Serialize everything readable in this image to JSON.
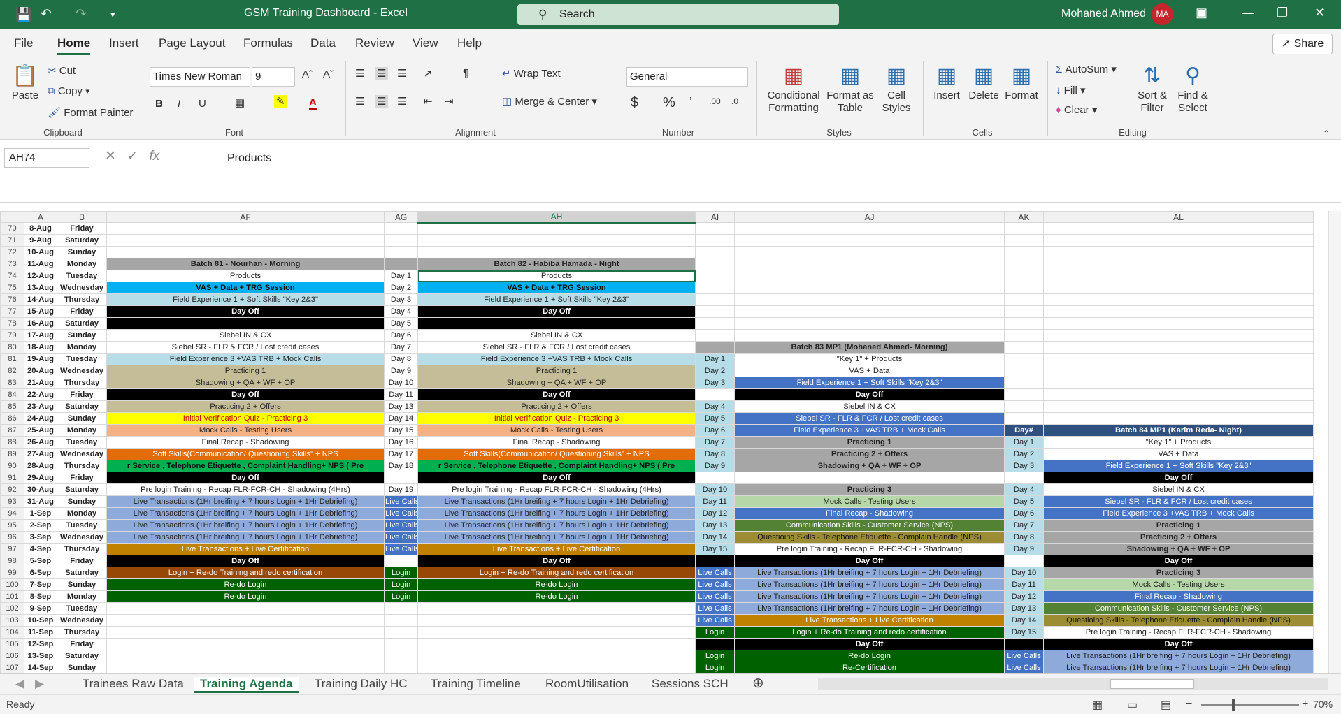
{
  "window": {
    "title": "GSM Training Dashboard  -  Excel",
    "search_placeholder": "Search",
    "user": "Mohaned Ahmed",
    "avatar": "MA"
  },
  "ribbon_tabs": [
    "File",
    "Home",
    "Insert",
    "Page Layout",
    "Formulas",
    "Data",
    "Review",
    "View",
    "Help"
  ],
  "share_label": "Share",
  "ribbon": {
    "clipboard": {
      "paste": "Paste",
      "cut": "Cut",
      "copy": "Copy",
      "format_painter": "Format Painter",
      "label": "Clipboard"
    },
    "font": {
      "name": "Times New Roman",
      "size": "9",
      "label": "Font",
      "bold": "B",
      "italic": "I",
      "underline": "U"
    },
    "alignment": {
      "wrap": "Wrap Text",
      "merge": "Merge & Center",
      "label": "Alignment"
    },
    "number": {
      "format": "General",
      "label": "Number"
    },
    "styles": {
      "cond": "Conditional Formatting",
      "table": "Format as Table",
      "cell": "Cell Styles",
      "label": "Styles"
    },
    "cells": {
      "insert": "Insert",
      "delete": "Delete",
      "format": "Format",
      "label": "Cells"
    },
    "editing": {
      "autosum": "AutoSum",
      "fill": "Fill",
      "clear": "Clear",
      "sort": "Sort & Filter",
      "find": "Find & Select",
      "label": "Editing"
    }
  },
  "formula_bar": {
    "cell_ref": "AH74",
    "content": "Products",
    "fx": "fx"
  },
  "columns": [
    "",
    "A",
    "B",
    "AF",
    "AG",
    "AH",
    "AI",
    "AJ",
    "AK",
    "AL",
    ""
  ],
  "rows": [
    {
      "n": "70",
      "a": "8-Aug",
      "b": "Friday",
      "c": []
    },
    {
      "n": "71",
      "a": "9-Aug",
      "b": "Saturday",
      "c": []
    },
    {
      "n": "72",
      "a": "10-Aug",
      "b": "Sunday",
      "c": []
    },
    {
      "n": "73",
      "a": "11-Aug",
      "b": "Monday",
      "c": [
        [
          "Batch 81  - Nourhan - Morning",
          "gray"
        ],
        [
          "",
          "gray"
        ],
        [
          "Batch 82  - Habiba Hamada - Night",
          "gray"
        ]
      ]
    },
    {
      "n": "74",
      "a": "12-Aug",
      "b": "Tuesday",
      "c": [
        [
          "Products",
          "white"
        ],
        [
          "Day 1",
          "white"
        ],
        [
          "Products",
          "white"
        ]
      ]
    },
    {
      "n": "75",
      "a": "13-Aug",
      "b": "Wednesday",
      "c": [
        [
          "VAS + Data  + TRG Session",
          "cyan"
        ],
        [
          "Day 2",
          "white"
        ],
        [
          "VAS + Data  + TRG Session",
          "cyan"
        ]
      ]
    },
    {
      "n": "76",
      "a": "14-Aug",
      "b": "Thursday",
      "c": [
        [
          "Field Experience 1 + Soft Skills \"Key 2&3\"",
          "lblue"
        ],
        [
          "Day 3",
          "white"
        ],
        [
          "Field Experience 1 + Soft Skills \"Key 2&3\"",
          "lblue"
        ]
      ]
    },
    {
      "n": "77",
      "a": "15-Aug",
      "b": "Friday",
      "c": [
        [
          "Day Off",
          "black"
        ],
        [
          "Day 4",
          "white"
        ],
        [
          "Day Off",
          "black"
        ]
      ]
    },
    {
      "n": "78",
      "a": "16-Aug",
      "b": "Saturday",
      "c": [
        [
          "",
          "black"
        ],
        [
          "Day 5",
          "white"
        ],
        [
          "",
          "black"
        ]
      ]
    },
    {
      "n": "79",
      "a": "17-Aug",
      "b": "Sunday",
      "c": [
        [
          "Siebel IN & CX",
          "white"
        ],
        [
          "Day 6",
          "white"
        ],
        [
          "Siebel IN & CX",
          "white"
        ]
      ]
    },
    {
      "n": "80",
      "a": "18-Aug",
      "b": "Monday",
      "c": [
        [
          "Siebel SR -  FLR & FCR / Lost credit cases",
          "white"
        ],
        [
          "Day 7",
          "white"
        ],
        [
          "Siebel SR -  FLR & FCR / Lost credit cases",
          "white"
        ],
        [
          "",
          "gray"
        ],
        [
          "Batch 83 MP1 (Mohaned Ahmed- Morning)",
          "gray"
        ]
      ]
    },
    {
      "n": "81",
      "a": "19-Aug",
      "b": "Tuesday",
      "c": [
        [
          "Field Experience 3 +VAS TRB + Mock Calls",
          "lblue"
        ],
        [
          "Day 8",
          "white"
        ],
        [
          "Field Experience 3 +VAS TRB + Mock Calls",
          "lblue"
        ],
        [
          "Day 1",
          "lblue"
        ],
        [
          "\"Key 1\" + Products",
          "white"
        ]
      ]
    },
    {
      "n": "82",
      "a": "20-Aug",
      "b": "Wednesday",
      "c": [
        [
          "Practicing 1",
          "tan"
        ],
        [
          "Day 9",
          "white"
        ],
        [
          "Practicing 1",
          "tan"
        ],
        [
          "Day 2",
          "lblue"
        ],
        [
          "VAS + Data",
          "white"
        ]
      ]
    },
    {
      "n": "83",
      "a": "21-Aug",
      "b": "Thursday",
      "c": [
        [
          "Shadowing  + QA +  WF + OP",
          "tan"
        ],
        [
          "Day 10",
          "white"
        ],
        [
          "Shadowing  + QA +  WF + OP",
          "tan"
        ],
        [
          "Day 3",
          "lblue"
        ],
        [
          "Field Experience 1 + Soft Skills \"Key 2&3\"",
          "blue"
        ]
      ]
    },
    {
      "n": "84",
      "a": "22-Aug",
      "b": "Friday",
      "c": [
        [
          "Day Off",
          "black"
        ],
        [
          "Day 11",
          "white"
        ],
        [
          "Day Off",
          "black"
        ],
        [
          "",
          "white"
        ],
        [
          "Day Off",
          "black"
        ]
      ]
    },
    {
      "n": "85",
      "a": "23-Aug",
      "b": "Saturday",
      "c": [
        [
          "Practicing 2  + Offers",
          "tan"
        ],
        [
          "Day 13",
          "white"
        ],
        [
          "Practicing 2  + Offers",
          "tan"
        ],
        [
          "Day 4",
          "lblue"
        ],
        [
          "Siebel IN & CX",
          "white"
        ]
      ]
    },
    {
      "n": "86",
      "a": "24-Aug",
      "b": "Sunday",
      "c": [
        [
          "Initial Verification Quiz - Practicing 3",
          "yellow"
        ],
        [
          "Day 14",
          "white"
        ],
        [
          "Initial Verification Quiz - Practicing 3",
          "yellow"
        ],
        [
          "Day 5",
          "lblue"
        ],
        [
          "Siebel SR -  FLR & FCR / Lost credit cases",
          "blue"
        ]
      ]
    },
    {
      "n": "87",
      "a": "25-Aug",
      "b": "Monday",
      "c": [
        [
          "Mock Calls - Testing Users",
          "peach"
        ],
        [
          "Day 15",
          "white"
        ],
        [
          "Mock Calls - Testing Users",
          "peach"
        ],
        [
          "Day 6",
          "lblue"
        ],
        [
          "Field Experience 3 +VAS TRB + Mock Calls",
          "blue"
        ],
        [
          "Day#",
          "dblue"
        ],
        [
          "Batch 84 MP1 (Karim Reda- Night)",
          "dblue"
        ]
      ]
    },
    {
      "n": "88",
      "a": "26-Aug",
      "b": "Tuesday",
      "c": [
        [
          "Final Recap - Shadowing",
          "white"
        ],
        [
          "Day 16",
          "white"
        ],
        [
          "Final Recap - Shadowing",
          "white"
        ],
        [
          "Day 7",
          "lblue"
        ],
        [
          "Practicing 1",
          "gray"
        ],
        [
          "Day 1",
          "lblue"
        ],
        [
          "\"Key 1\" + Products",
          "white"
        ]
      ]
    },
    {
      "n": "89",
      "a": "27-Aug",
      "b": "Wednesday",
      "c": [
        [
          "Soft Skills(Communication/ Questioning Skills\" + NPS",
          "orange"
        ],
        [
          "Day 17",
          "white"
        ],
        [
          "Soft Skills(Communication/ Questioning Skills\" + NPS",
          "orange"
        ],
        [
          "Day 8",
          "lblue"
        ],
        [
          "Practicing 2  + Offers",
          "gray"
        ],
        [
          "Day 2",
          "lblue"
        ],
        [
          "VAS + Data",
          "white"
        ]
      ]
    },
    {
      "n": "90",
      "a": "28-Aug",
      "b": "Thursday",
      "c": [
        [
          "r Service , Telephone Etiquette , Complaint Handling+ NPS ( Pre",
          "green"
        ],
        [
          "Day 18",
          "white"
        ],
        [
          "r Service , Telephone Etiquette , Complaint Handling+ NPS ( Pre",
          "green"
        ],
        [
          "Day 9",
          "lblue"
        ],
        [
          "Shadowing  + QA +  WF + OP",
          "gray"
        ],
        [
          "Day 3",
          "lblue"
        ],
        [
          "Field Experience 1 + Soft Skills \"Key 2&3\"",
          "blue"
        ]
      ]
    },
    {
      "n": "91",
      "a": "29-Aug",
      "b": "Friday",
      "c": [
        [
          "Day Off",
          "black"
        ],
        [
          "",
          "white"
        ],
        [
          "Day Off",
          "black"
        ],
        [
          "",
          "white"
        ],
        [
          "",
          "white"
        ],
        [
          "",
          "white"
        ],
        [
          "Day Off",
          "black"
        ]
      ]
    },
    {
      "n": "92",
      "a": "30-Aug",
      "b": "Saturday",
      "c": [
        [
          "Pre login Training  - Recap FLR-FCR-CH - Shadowing (4Hrs)",
          "white"
        ],
        [
          "Day 19",
          "white"
        ],
        [
          "Pre login Training  - Recap FLR-FCR-CH - Shadowing (4Hrs)",
          "white"
        ],
        [
          "Day 10",
          "lblue"
        ],
        [
          "Practicing 3",
          "gray"
        ],
        [
          "Day 4",
          "lblue"
        ],
        [
          "Siebel IN & CX",
          "white"
        ]
      ]
    },
    {
      "n": "93",
      "a": "31-Aug",
      "b": "Sunday",
      "c": [
        [
          "Live Transactions  (1Hr breifing + 7 hours Login  + 1Hr Debriefing)",
          "sblue"
        ],
        [
          "Live Calls",
          "blue"
        ],
        [
          "Live Transactions  (1Hr breifing + 7 hours Login  + 1Hr Debriefing)",
          "sblue"
        ],
        [
          "Day 11",
          "lblue"
        ],
        [
          "Mock Calls - Testing Users",
          "lgreen"
        ],
        [
          "Day 5",
          "lblue"
        ],
        [
          "Siebel SR -  FLR & FCR / Lost credit cases",
          "blue"
        ]
      ]
    },
    {
      "n": "94",
      "a": "1-Sep",
      "b": "Monday",
      "c": [
        [
          "Live Transactions  (1Hr breifing + 7 hours Login  + 1Hr Debriefing)",
          "sblue"
        ],
        [
          "Live Calls",
          "blue"
        ],
        [
          "Live Transactions  (1Hr breifing + 7 hours Login  + 1Hr Debriefing)",
          "sblue"
        ],
        [
          "Day 12",
          "lblue"
        ],
        [
          "Final Recap - Shadowing",
          "blue"
        ],
        [
          "Day 6",
          "lblue"
        ],
        [
          "Field Experience 3 +VAS TRB + Mock Calls",
          "blue"
        ]
      ]
    },
    {
      "n": "95",
      "a": "2-Sep",
      "b": "Tuesday",
      "c": [
        [
          "Live Transactions  (1Hr breifing + 7 hours Login  + 1Hr Debriefing)",
          "sblue"
        ],
        [
          "Live Calls",
          "blue"
        ],
        [
          "Live Transactions  (1Hr breifing + 7 hours Login  + 1Hr Debriefing)",
          "sblue"
        ],
        [
          "Day 13",
          "lblue"
        ],
        [
          "Communication Skills - Customer Service (NPS)",
          "ogreen"
        ],
        [
          "Day 7",
          "lblue"
        ],
        [
          "Practicing 1",
          "gray"
        ]
      ]
    },
    {
      "n": "96",
      "a": "3-Sep",
      "b": "Wednesday",
      "c": [
        [
          "Live Transactions  (1Hr breifing + 7 hours Login  + 1Hr Debriefing)",
          "sblue"
        ],
        [
          "Live Calls",
          "blue"
        ],
        [
          "Live Transactions  (1Hr breifing + 7 hours Login  + 1Hr Debriefing)",
          "sblue"
        ],
        [
          "Day 14",
          "lblue"
        ],
        [
          "Questioing Skills - Telephone Etiquette - Complain Handle (NPS)",
          "olive"
        ],
        [
          "Day 8",
          "lblue"
        ],
        [
          "Practicing 2  + Offers",
          "gray"
        ]
      ]
    },
    {
      "n": "97",
      "a": "4-Sep",
      "b": "Thursday",
      "c": [
        [
          "Live Transactions + Live Certification",
          "amber"
        ],
        [
          "Live Calls",
          "blue"
        ],
        [
          "Live Transactions + Live Certification",
          "amber"
        ],
        [
          "Day 15",
          "lblue"
        ],
        [
          "Pre login Training  - Recap FLR-FCR-CH - Shadowing",
          "white"
        ],
        [
          "Day 9",
          "lblue"
        ],
        [
          "Shadowing  + QA +  WF + OP",
          "gray"
        ]
      ]
    },
    {
      "n": "98",
      "a": "5-Sep",
      "b": "Friday",
      "c": [
        [
          "Day Off",
          "black"
        ],
        [
          "",
          "white"
        ],
        [
          "Day Off",
          "black"
        ],
        [
          "",
          "black"
        ],
        [
          "Day Off",
          "black"
        ],
        [
          "",
          "white"
        ],
        [
          "Day Off",
          "black"
        ]
      ]
    },
    {
      "n": "99",
      "a": "6-Sep",
      "b": "Saturday",
      "c": [
        [
          "Login + Re-do Training and redo certification",
          "brown"
        ],
        [
          "Login",
          "dgreen"
        ],
        [
          "Login + Re-do Training and redo certification",
          "brown"
        ],
        [
          "Live Calls",
          "blue"
        ],
        [
          "Live Transactions  (1Hr breifing + 7 hours Login  + 1Hr Debriefing)",
          "sblue"
        ],
        [
          "Day 10",
          "lblue"
        ],
        [
          "Practicing 3",
          "gray"
        ]
      ]
    },
    {
      "n": "100",
      "a": "7-Sep",
      "b": "Sunday",
      "c": [
        [
          "Re-do Login",
          "dgreen"
        ],
        [
          "Login",
          "dgreen"
        ],
        [
          "Re-do Login",
          "dgreen"
        ],
        [
          "Live Calls",
          "blue"
        ],
        [
          "Live Transactions  (1Hr breifing + 7 hours Login  + 1Hr Debriefing)",
          "sblue"
        ],
        [
          "Day 11",
          "lblue"
        ],
        [
          "Mock Calls - Testing Users",
          "lgreen"
        ]
      ]
    },
    {
      "n": "101",
      "a": "8-Sep",
      "b": "Monday",
      "c": [
        [
          "Re-do Login",
          "dgreen"
        ],
        [
          "Login",
          "dgreen"
        ],
        [
          "Re-do Login",
          "dgreen"
        ],
        [
          "Live Calls",
          "blue"
        ],
        [
          "Live Transactions  (1Hr breifing + 7 hours Login  + 1Hr Debriefing)",
          "sblue"
        ],
        [
          "Day 12",
          "lblue"
        ],
        [
          "Final Recap - Shadowing",
          "blue"
        ]
      ]
    },
    {
      "n": "102",
      "a": "9-Sep",
      "b": "Tuesday",
      "c": [
        [
          "",
          "white"
        ],
        [
          "",
          "white"
        ],
        [
          "",
          "white"
        ],
        [
          "Live Calls",
          "blue"
        ],
        [
          "Live Transactions  (1Hr breifing + 7 hours Login  + 1Hr Debriefing)",
          "sblue"
        ],
        [
          "Day 13",
          "lblue"
        ],
        [
          "Communication Skills - Customer Service (NPS)",
          "ogreen"
        ]
      ]
    },
    {
      "n": "103",
      "a": "10-Sep",
      "b": "Wednesday",
      "c": [
        [
          "",
          "white"
        ],
        [
          "",
          "white"
        ],
        [
          "",
          "white"
        ],
        [
          "Live Calls",
          "blue"
        ],
        [
          "Live Transactions + Live Certification",
          "amber"
        ],
        [
          "Day 14",
          "lblue"
        ],
        [
          "Questioing Skills - Telephone Etiquette - Complain Handle (NPS)",
          "olive"
        ]
      ]
    },
    {
      "n": "104",
      "a": "11-Sep",
      "b": "Thursday",
      "c": [
        [
          "",
          "white"
        ],
        [
          "",
          "white"
        ],
        [
          "",
          "white"
        ],
        [
          "Login",
          "dgreen"
        ],
        [
          "Login + Re-do Training and redo certification",
          "dgreen"
        ],
        [
          "Day 15",
          "lblue"
        ],
        [
          "Pre login Training  - Recap FLR-FCR-CH - Shadowing",
          "white"
        ]
      ]
    },
    {
      "n": "105",
      "a": "12-Sep",
      "b": "Friday",
      "c": [
        [
          "",
          "white"
        ],
        [
          "",
          "white"
        ],
        [
          "",
          "white"
        ],
        [
          "",
          "black"
        ],
        [
          "Day Off",
          "black"
        ],
        [
          "",
          "black"
        ],
        [
          "Day Off",
          "black"
        ]
      ]
    },
    {
      "n": "106",
      "a": "13-Sep",
      "b": "Saturday",
      "c": [
        [
          "",
          "white"
        ],
        [
          "",
          "white"
        ],
        [
          "",
          "white"
        ],
        [
          "Login",
          "dgreen"
        ],
        [
          "Re-do Login",
          "dgreen"
        ],
        [
          "Live Calls",
          "blue"
        ],
        [
          "Live Transactions  (1Hr breifing + 7 hours Login  + 1Hr Debriefing)",
          "sblue"
        ]
      ]
    },
    {
      "n": "107",
      "a": "14-Sep",
      "b": "Sunday",
      "c": [
        [
          "",
          "white"
        ],
        [
          "",
          "white"
        ],
        [
          "",
          "white"
        ],
        [
          "Login",
          "dgreen"
        ],
        [
          "Re-Certification",
          "dgreen"
        ],
        [
          "Live Calls",
          "blue"
        ],
        [
          "Live Transactions  (1Hr breifing + 7 hours Login  + 1Hr Debriefing)",
          "sblue"
        ]
      ]
    }
  ],
  "sheet_tabs": [
    "Trainees Raw Data",
    "Training Agenda",
    "Training Daily HC",
    "Training Timeline",
    "RoomUtilisation",
    "Sessions SCH"
  ],
  "status": {
    "ready": "Ready",
    "zoom": "70%"
  }
}
